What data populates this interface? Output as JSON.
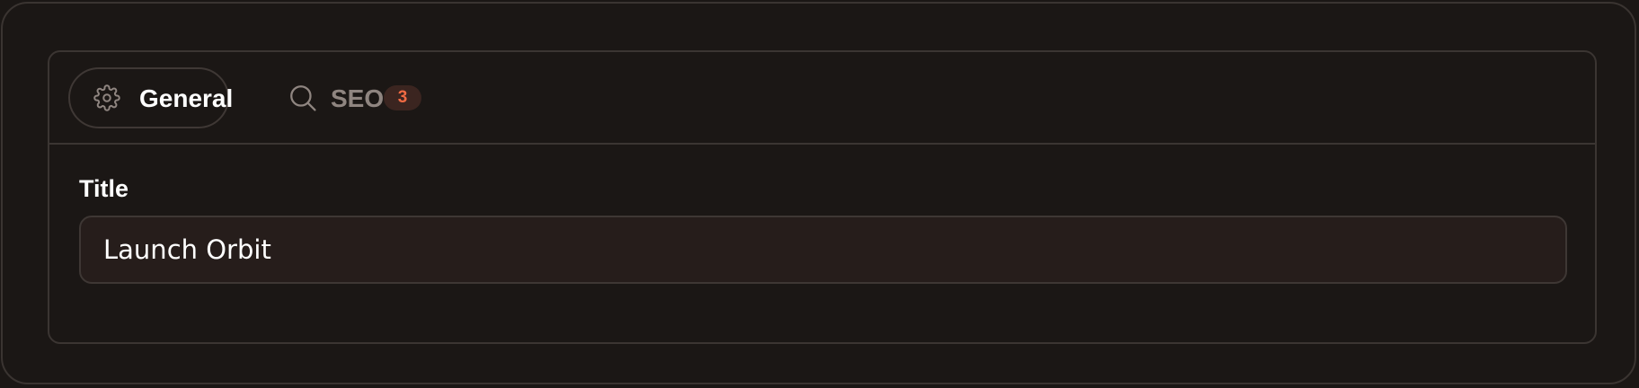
{
  "tabs": [
    {
      "label": "General",
      "icon": "gear-icon",
      "active": true
    },
    {
      "label": "SEO",
      "icon": "search-icon",
      "active": false,
      "badge": "3"
    }
  ],
  "form": {
    "title_label": "Title",
    "title_value": "Launch Orbit"
  },
  "colors": {
    "background": "#1b1715",
    "border": "#3b3532",
    "badge_bg": "#3b2520",
    "badge_text": "#f06a43",
    "inactive_tab_text": "#8f8580"
  }
}
